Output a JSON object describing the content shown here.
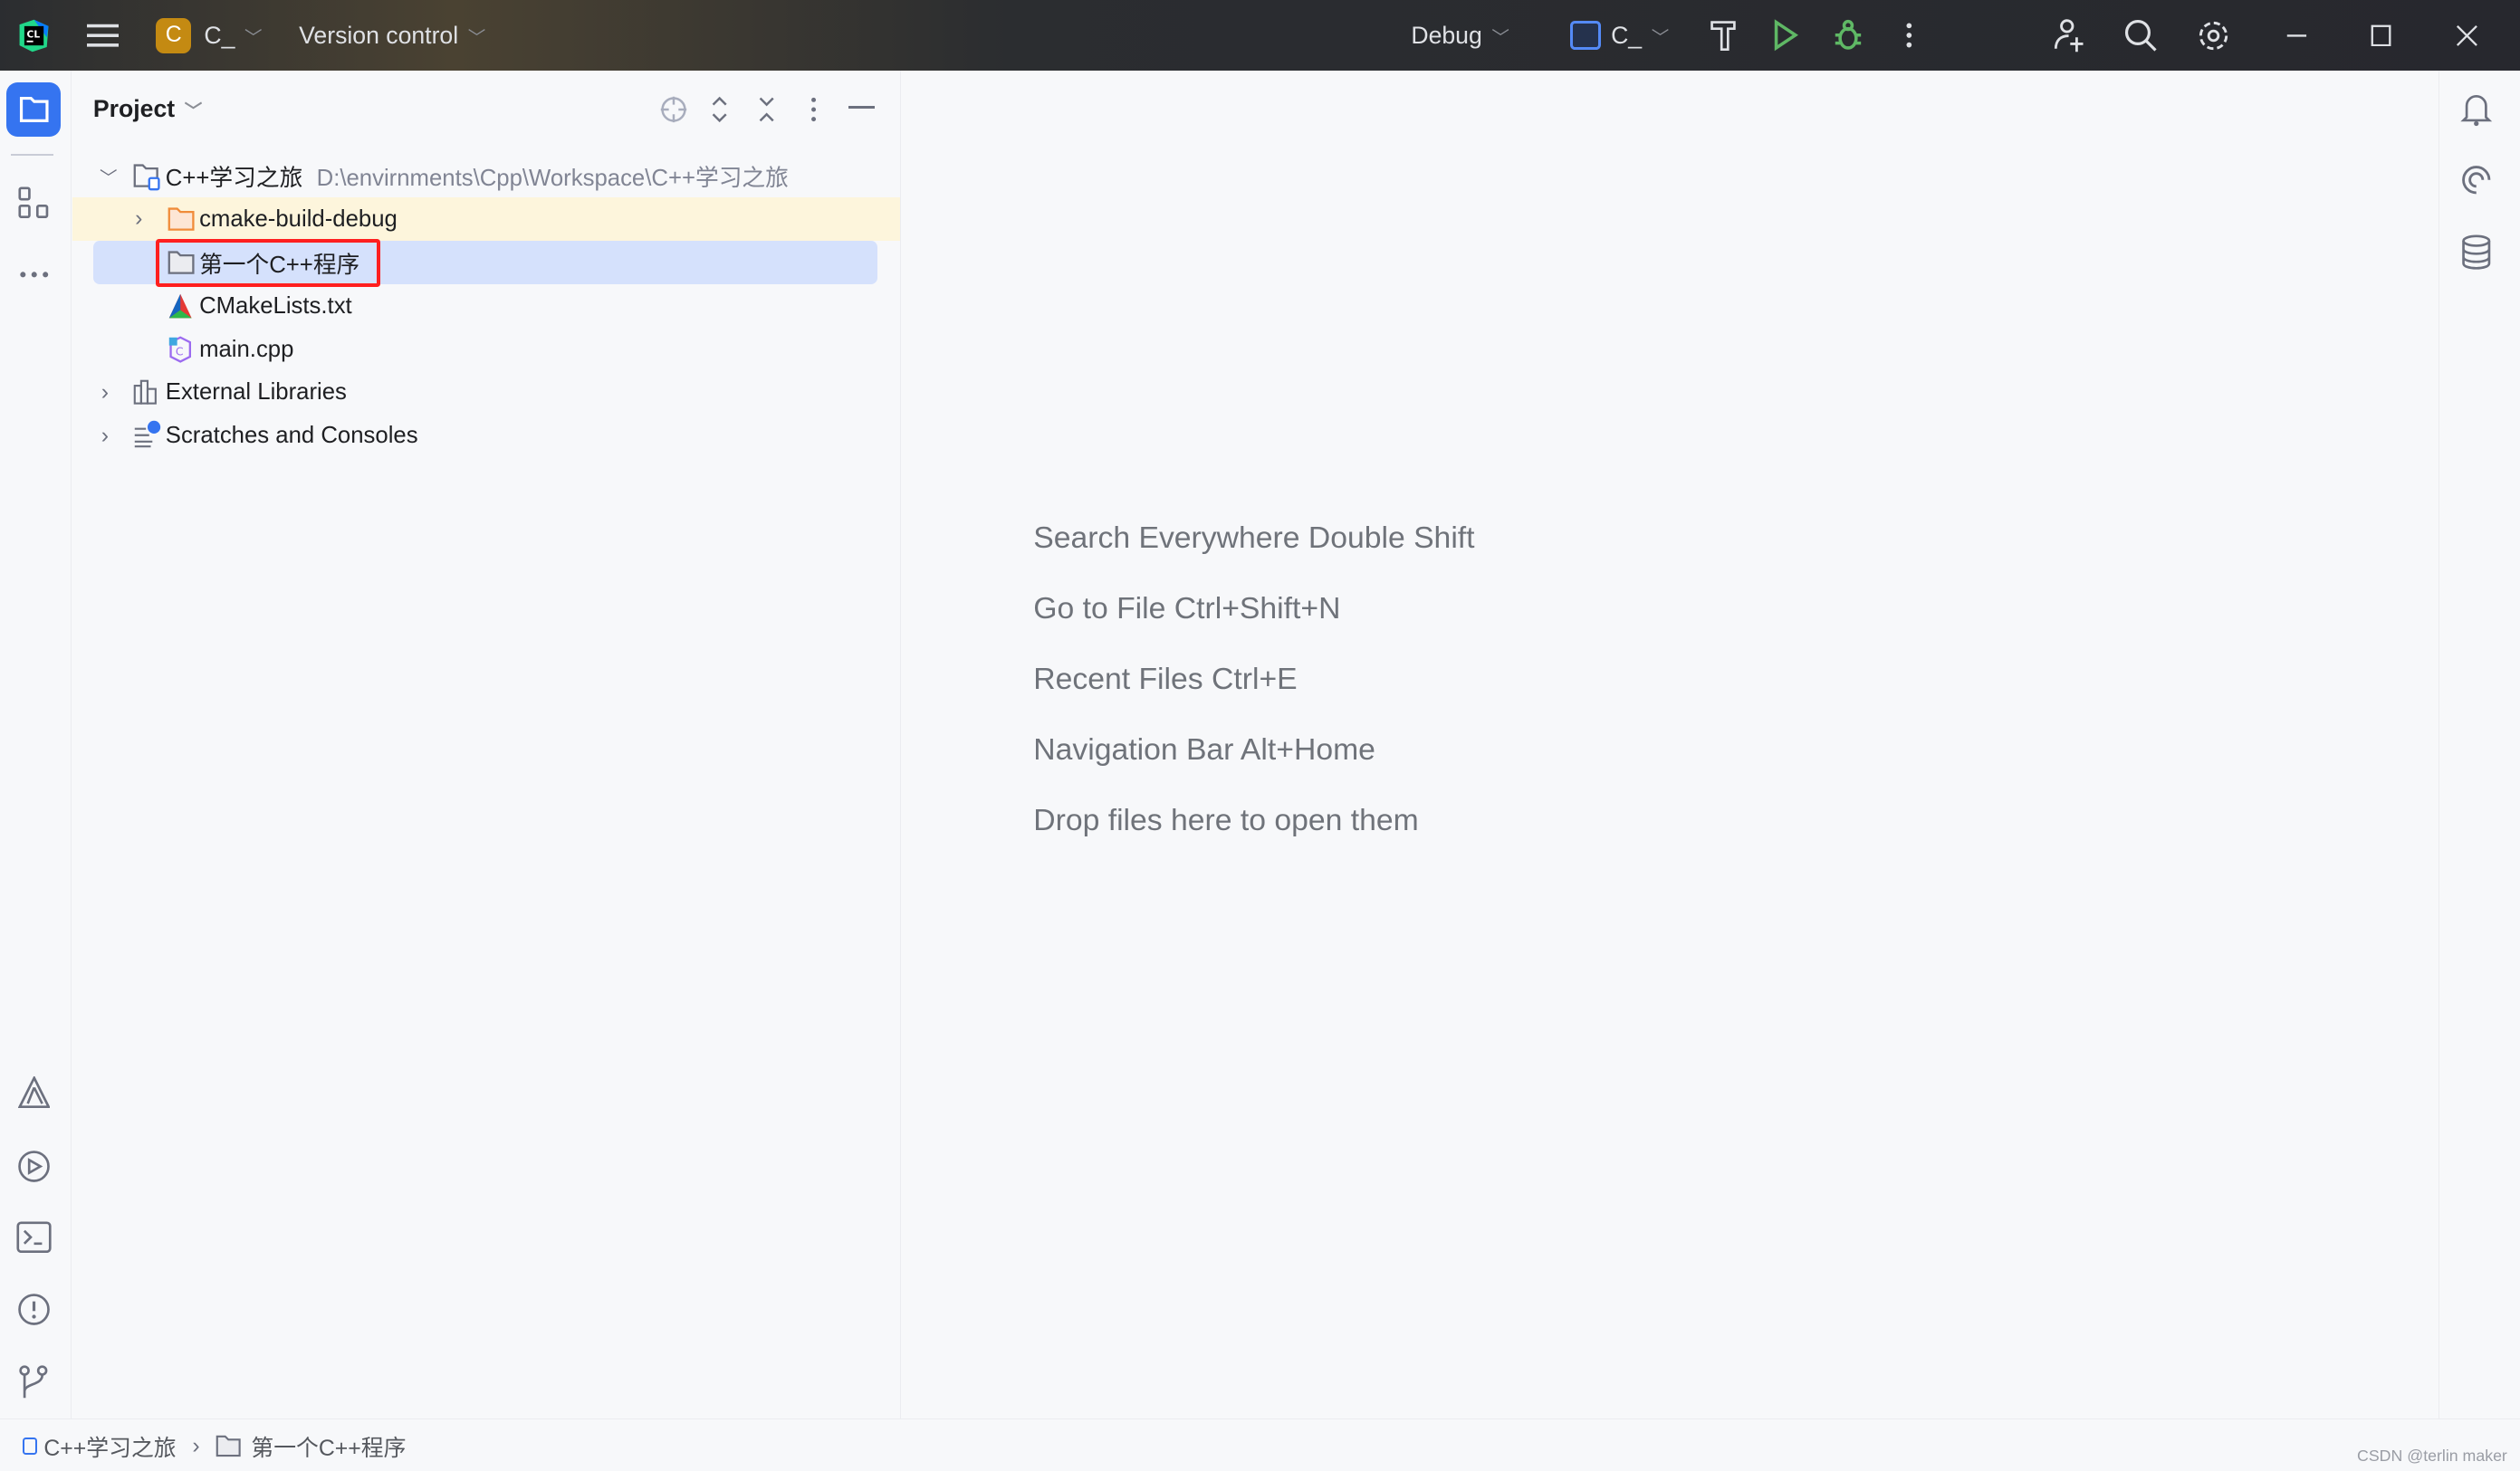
{
  "titlebar": {
    "project_badge": "C",
    "project_name": "C_",
    "vcs": "Version control",
    "config": "Debug",
    "run_target": "C_"
  },
  "project_panel": {
    "title": "Project",
    "tree": [
      {
        "label": "C++学习之旅",
        "path": "D:\\envirnments\\Cpp\\Workspace\\C++学习之旅",
        "icon": "module-folder-icon",
        "expanded": true
      },
      {
        "label": "cmake-build-debug",
        "icon": "folder-icon",
        "expanded": false
      },
      {
        "label": "第一个C++程序",
        "icon": "folder-icon",
        "selected": true
      },
      {
        "label": "CMakeLists.txt",
        "icon": "cmake-icon"
      },
      {
        "label": "main.cpp",
        "icon": "cpp-file-icon"
      },
      {
        "label": "External Libraries",
        "icon": "library-icon",
        "expanded": false
      },
      {
        "label": "Scratches and Consoles",
        "icon": "scratches-icon",
        "expanded": false
      }
    ]
  },
  "editor_hints": [
    "Search Everywhere Double Shift",
    "Go to File Ctrl+Shift+N",
    "Recent Files Ctrl+E",
    "Navigation Bar Alt+Home",
    "Drop files here to open them"
  ],
  "breadcrumb": [
    "C++学习之旅",
    "第一个C++程序"
  ],
  "watermark": "CSDN @terlin maker",
  "colors": {
    "accent": "#3574f0",
    "highlight_box": "#ff1f1f",
    "selection": "#d5e1fc",
    "excluded_row": "#fdf5dc",
    "run": "#5fb865"
  }
}
